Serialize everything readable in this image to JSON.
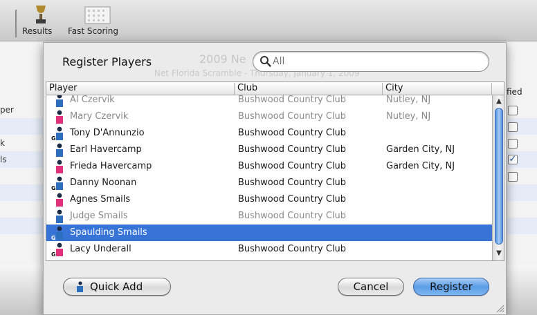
{
  "toolbar": {
    "items": [
      {
        "label": "Results",
        "icon": "trophy-icon"
      },
      {
        "label": "Fast Scoring",
        "icon": "scorecard-icon"
      }
    ]
  },
  "background": {
    "ghost_title": "2009 Ne",
    "ghost_subtitle": "Net Florida Scramble - Thursday, January 1, 2009",
    "row_fragments": [
      "per",
      "k",
      "ls"
    ],
    "column_fragment": "fied"
  },
  "dialog": {
    "title": "Register Players",
    "search": {
      "placeholder": "All",
      "value": ""
    },
    "columns": {
      "player": "Player",
      "club": "Club",
      "city": "City"
    },
    "players": [
      {
        "name": "Al Czervik",
        "club": "Bushwood Country Club",
        "city": "Nutley, NJ",
        "gender": "male",
        "guest": false,
        "dim": true,
        "selected": false
      },
      {
        "name": "Mary Czervik",
        "club": "Bushwood Country Club",
        "city": "Nutley, NJ",
        "gender": "female",
        "guest": false,
        "dim": true,
        "selected": false
      },
      {
        "name": "Tony D'Annunzio",
        "club": "Bushwood Country Club",
        "city": "",
        "gender": "male",
        "guest": true,
        "dim": false,
        "selected": false
      },
      {
        "name": "Earl Havercamp",
        "club": "Bushwood Country Club",
        "city": "Garden City, NJ",
        "gender": "male",
        "guest": false,
        "dim": false,
        "selected": false
      },
      {
        "name": "Frieda Havercamp",
        "club": "Bushwood Country Club",
        "city": "Garden City, NJ",
        "gender": "female",
        "guest": false,
        "dim": false,
        "selected": false
      },
      {
        "name": "Danny Noonan",
        "club": "Bushwood Country Club",
        "city": "",
        "gender": "male",
        "guest": true,
        "dim": false,
        "selected": false
      },
      {
        "name": "Agnes Smails",
        "club": "Bushwood Country Club",
        "city": "",
        "gender": "female",
        "guest": false,
        "dim": false,
        "selected": false
      },
      {
        "name": "Judge Smails",
        "club": "Bushwood Country Club",
        "city": "",
        "gender": "male",
        "guest": false,
        "dim": true,
        "selected": false
      },
      {
        "name": "Spaulding Smails",
        "club": "",
        "city": "",
        "gender": "male",
        "guest": true,
        "dim": false,
        "selected": true
      },
      {
        "name": "Lacy Underall",
        "club": "Bushwood Country Club",
        "city": "",
        "gender": "female",
        "guest": true,
        "dim": false,
        "selected": false
      }
    ],
    "buttons": {
      "quick_add": "Quick Add",
      "cancel": "Cancel",
      "register": "Register"
    }
  },
  "colors": {
    "selection": "#3874d7",
    "male_shirt": "#2d6fbf",
    "female_shirt": "#e0307a",
    "primary_button": "#5b9de6"
  }
}
